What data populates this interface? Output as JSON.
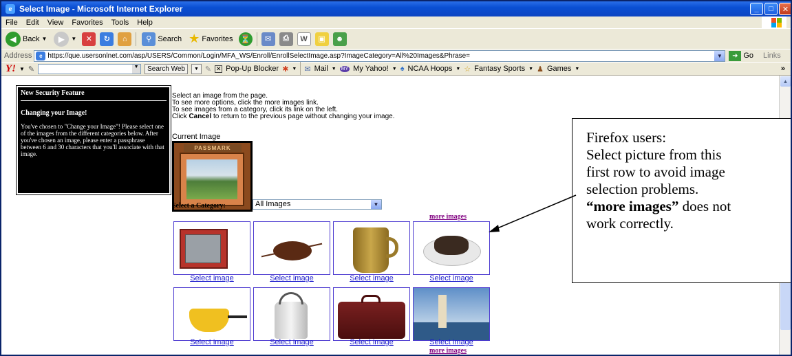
{
  "window": {
    "title": "Select Image - Microsoft Internet Explorer",
    "min": "_",
    "max": "□",
    "close": "✕"
  },
  "menu": [
    "File",
    "Edit",
    "View",
    "Favorites",
    "Tools",
    "Help"
  ],
  "toolbar": {
    "back": "Back",
    "search": "Search",
    "favorites": "Favorites"
  },
  "address": {
    "label": "Address",
    "url": "https://que.usersonlnet.com/asp/USERS/Common/Login/MFA_WS/Enroll/EnrollSelectImage.asp?ImageCategory=All%20Images&Phrase=",
    "go": "Go",
    "links": "Links"
  },
  "yahoo": {
    "search_web": "Search Web",
    "popup": "Pop-Up Blocker",
    "mail": "Mail",
    "my_yahoo": "My Yahoo!",
    "ncaa": "NCAA Hoops",
    "fantasy": "Fantasy Sports",
    "games": "Games",
    "more": "»"
  },
  "security": {
    "title": "New Security Feature",
    "subtitle": "Changing your Image!",
    "body": "You've chosen to \"Change your Image\"! Please select one of the images from the different categories below. After you've chosen an image, please enter a passphrase between 6 and 30 characters that you'll associate with that image."
  },
  "instructions": {
    "line1": "Select an image from the page.",
    "line2": "To see more options, click the more images link.",
    "line3": "To see images from a category, click its link on the left.",
    "line4_pre": "Click ",
    "line4_bold": "Cancel",
    "line4_post": " to return to the previous page without changing your image."
  },
  "current_image": {
    "label": "Current Image",
    "banner": "PASSMARK"
  },
  "category": {
    "label": "Select a Category:",
    "selected": "All Images"
  },
  "more_images": "more images",
  "select_image": "Select image",
  "thumbnails": [
    "red-speaker",
    "crab",
    "ceramic-pitcher",
    "mussels-pasta",
    "yellow-fondue-pot",
    "white-kettle",
    "leather-suitcase",
    "lighthouse"
  ],
  "callout": {
    "line1": "Firefox users:",
    "line2": "Select picture from this",
    "line3": "first row to avoid image",
    "line4": "selection problems.",
    "line5_bold": "“more images”",
    "line5_rest": " does not",
    "line6": "work correctly."
  }
}
